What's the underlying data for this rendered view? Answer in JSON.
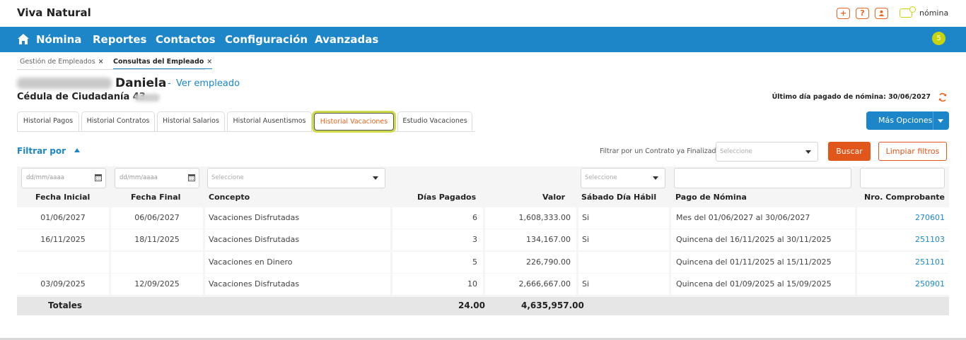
{
  "app": {
    "title": "Viva Natural",
    "brand_product": "nómina"
  },
  "topbar": {
    "icons": [
      {
        "name": "add-icon",
        "glyph": "+"
      },
      {
        "name": "help-icon",
        "glyph": "?"
      },
      {
        "name": "user-icon",
        "glyph": "●"
      }
    ]
  },
  "nav": {
    "items": [
      "Nómina",
      "Reportes",
      "Contactos",
      "Configuración",
      "Avanzadas"
    ],
    "notifications": "5"
  },
  "breadcrumbs": [
    {
      "label": "Gestión de Empleados",
      "close": "×"
    },
    {
      "label": "Consultas del Empleado",
      "close": "×"
    }
  ],
  "employee": {
    "name": "Daniela",
    "separator": "-",
    "link": "Ver empleado",
    "id_label": "Cédula de Ciudadanía 43",
    "last_paid": "Último día pagado de nómina: 30/06/2027"
  },
  "tabs": [
    "Historial Pagos",
    "Historial Contratos",
    "Historial Salarios",
    "Historial Ausentismos",
    "Historial Vacaciones",
    "Estudio Vacaciones"
  ],
  "active_tab": "Historial Vacaciones",
  "more_options": "Más Opciones",
  "filters": {
    "toggle_label": "Filtrar por",
    "contract_label": "Filtrar por un Contrato ya Finalizado",
    "contract_placeholder": "Seleccione",
    "search_button": "Buscar",
    "clear_button": "Limpiar filtros",
    "date_placeholder": "dd/mm/aaaa",
    "concept_placeholder": "Seleccione",
    "saturday_placeholder": "Seleccione"
  },
  "table": {
    "columns": [
      "Fecha Inicial",
      "Fecha Final",
      "Concepto",
      "Días Pagados",
      "Valor",
      "Sábado Día Hábil",
      "Pago de Nómina",
      "Nro. Comprobante"
    ],
    "rows": [
      [
        "01/06/2027",
        "06/06/2027",
        "Vacaciones Disfrutadas",
        "6",
        "1,608,333.00",
        "Si",
        "Mes del 01/06/2027 al 30/06/2027",
        "270601"
      ],
      [
        "16/11/2025",
        "18/11/2025",
        "Vacaciones Disfrutadas",
        "3",
        "134,167.00",
        "Si",
        "Quincena del 16/11/2025 al 30/11/2025",
        "251103"
      ],
      [
        "",
        "",
        "Vacaciones en Dinero",
        "5",
        "226,790.00",
        "",
        "Quincena del 01/11/2025 al 15/11/2025",
        "251101"
      ],
      [
        "03/09/2025",
        "12/09/2025",
        "Vacaciones Disfrutadas",
        "10",
        "2,666,667.00",
        "Si",
        "Quincena del 01/09/2025 al 15/09/2025",
        "250901"
      ]
    ],
    "totals": {
      "label": "Totales",
      "days": "24.00",
      "value": "4,635,957.00"
    }
  },
  "colors": {
    "primary": "#1c86c8",
    "accent": "#e0561b",
    "highlight": "#cfdc4a"
  }
}
